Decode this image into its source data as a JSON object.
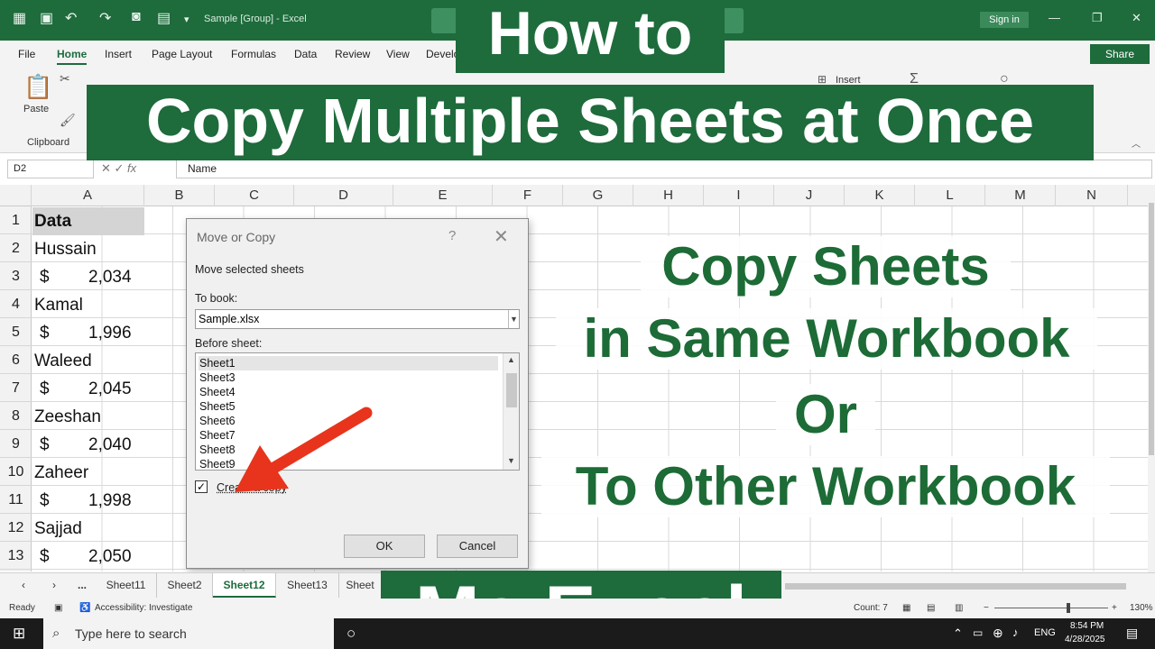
{
  "window": {
    "title": "Sample [Group] - Excel",
    "signin": "Sign in"
  },
  "menu": {
    "items": [
      "File",
      "Home",
      "Insert",
      "Page Layout",
      "Formulas",
      "Data",
      "Review",
      "View",
      "Develo"
    ],
    "share": "Share"
  },
  "ribbon": {
    "paste": "Paste",
    "clipboard": "Clipboard",
    "insert": "Insert"
  },
  "formula_bar": {
    "name_box": "D2",
    "fx": "fx",
    "value": "Name"
  },
  "columns": [
    "A",
    "B",
    "C",
    "D",
    "E",
    "F",
    "G",
    "H",
    "I",
    "J",
    "K",
    "L",
    "M",
    "N"
  ],
  "rows": [
    "1",
    "2",
    "3",
    "4",
    "5",
    "6",
    "7",
    "8",
    "9",
    "10",
    "11",
    "12",
    "13"
  ],
  "cells": {
    "a1": "Data",
    "names": [
      "Hussain",
      "Kamal",
      "Waleed",
      "Zeeshan",
      "Zaheer",
      "Sajjad"
    ],
    "currency": "$",
    "amounts": [
      "2,034",
      "1,996",
      "2,045",
      "2,040",
      "1,998",
      "2,050"
    ]
  },
  "dialog": {
    "title": "Move or Copy",
    "help": "?",
    "close": "✕",
    "move_label": "Move selected sheets",
    "to_book_label": "To book:",
    "to_book_value": "Sample.xlsx",
    "before_label": "Before sheet:",
    "sheets": [
      "Sheet1",
      "Sheet3",
      "Sheet4",
      "Sheet5",
      "Sheet6",
      "Sheet7",
      "Sheet8",
      "Sheet9"
    ],
    "create_copy": "Create a copy",
    "create_copy_checked": true,
    "ok": "OK",
    "cancel": "Cancel"
  },
  "overlay": {
    "line1": "How to",
    "line2": "Copy Multiple Sheets at Once",
    "right": [
      "Copy Sheets",
      "in Same Workbook",
      "Or",
      "To Other Workbook"
    ],
    "bottom": "Ms Excel",
    "accent": "#1e6b3c"
  },
  "tabs": {
    "ellipsis": "...",
    "items": [
      "Sheet11",
      "Sheet2",
      "Sheet12",
      "Sheet13",
      "Sheet"
    ],
    "active": "Sheet12"
  },
  "status": {
    "ready": "Ready",
    "accessibility": "Accessibility: Investigate",
    "count": "Count: 7",
    "zoom": "130%"
  },
  "taskbar": {
    "search": "Type here to search",
    "lang": "ENG",
    "time": "8:54 PM",
    "date": "4/28/2025"
  }
}
